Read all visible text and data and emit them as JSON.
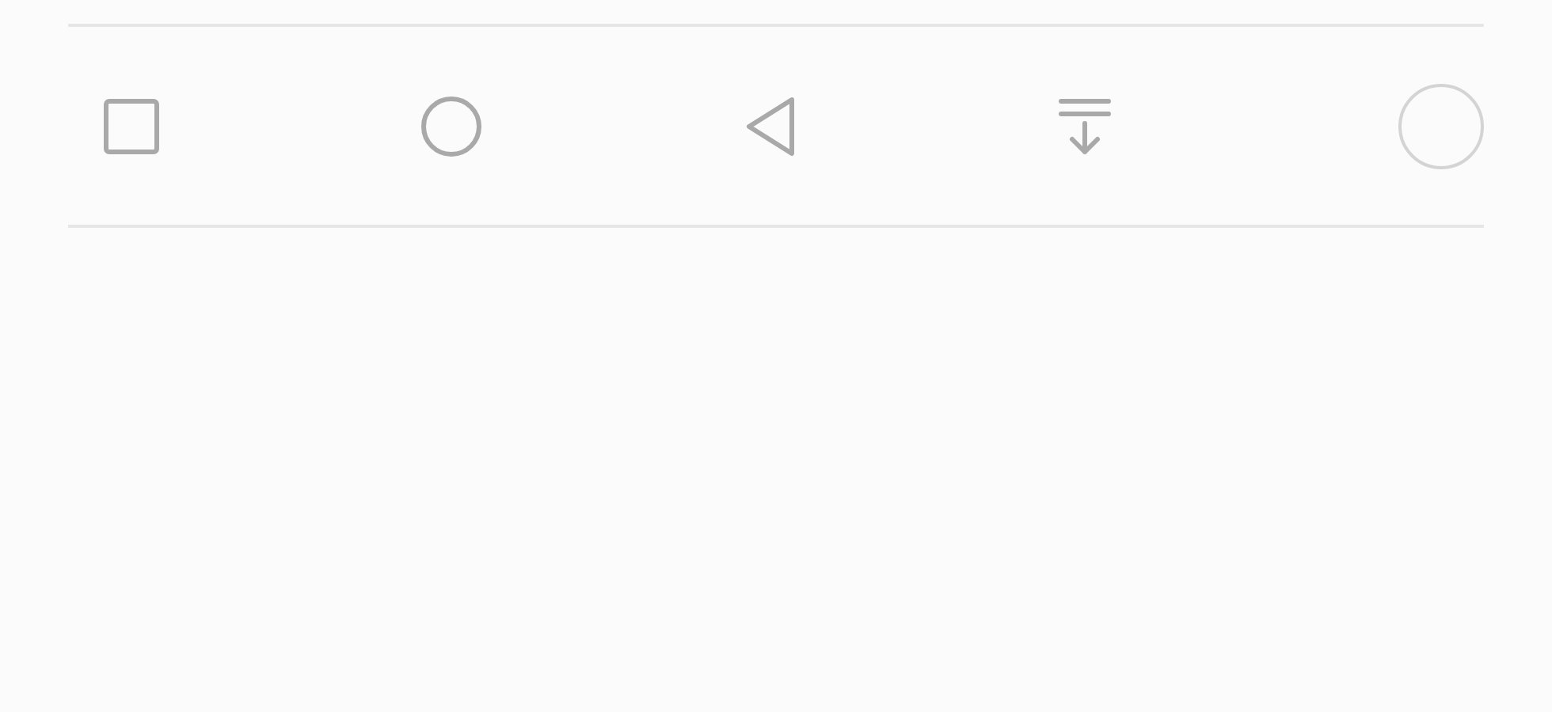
{
  "navigation_layout_option": {
    "selected": false
  }
}
